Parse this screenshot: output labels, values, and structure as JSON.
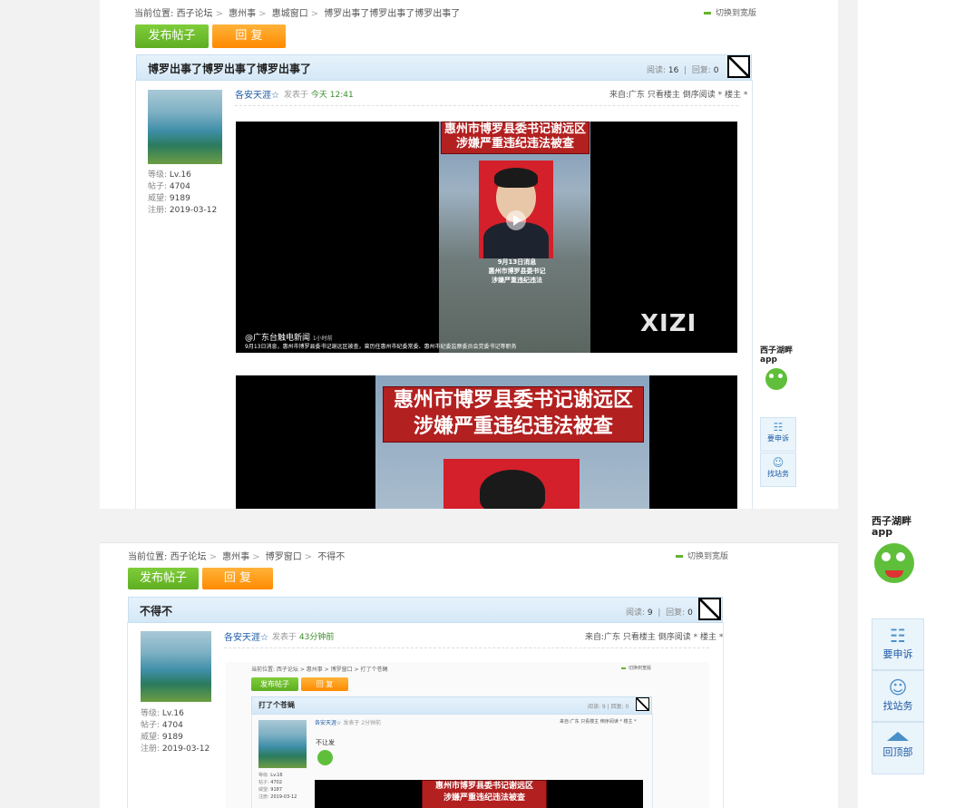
{
  "colors": {
    "accent_green": "#65b32e",
    "accent_orange": "#ff8a00",
    "bar_blue": "#d5e8f7",
    "link_blue": "#1d5aa6",
    "video_red": "#b32020"
  },
  "top_post": {
    "breadcrumb": {
      "prefix": "当前位置:",
      "items": [
        "西子论坛",
        "惠州事",
        "惠城窗口",
        "博罗出事了博罗出事了博罗出事了"
      ]
    },
    "widen_label": "切换到宽版",
    "buttons": {
      "post": "发布帖子",
      "reply": "回 复"
    },
    "title": "博罗出事了博罗出事了博罗出事了",
    "reads_label": "阅读:",
    "reads": "16",
    "replies_label": "回复:",
    "replies": "0",
    "author": {
      "name": "各安天涯☆",
      "meta": [
        {
          "k": "等级:",
          "v": "Lv.16"
        },
        {
          "k": "帖子:",
          "v": "4704"
        },
        {
          "k": "威望:",
          "v": "9189"
        },
        {
          "k": "注册:",
          "v": "2019-03-12"
        }
      ]
    },
    "posted_prefix": "发表于",
    "posted_time": "今天 12:41",
    "source": "来自:广东 只看楼主 倒序阅读 * 楼主 *",
    "video1": {
      "banner": [
        "惠州市博罗县委书记谢远区",
        "涉嫌严重违纪违法被查"
      ],
      "caption_lines": [
        "9月13日消息",
        "惠州市博罗县委书记",
        "涉嫌严重违纪违法"
      ],
      "channel": "@广东台触电新闻",
      "time_ago": "1小时前",
      "subtitle": "9月13日消息，惠州市博罗县委书记谢远区被查，曾历任惠州市纪委常委、惠州市纪委监察委员会党委书记等职务",
      "watermark": "XIZI"
    },
    "video2": {
      "banner": [
        "惠州市博罗县委书记谢远区",
        "涉嫌严重违纪违法被查"
      ]
    }
  },
  "side_small": {
    "app_line1": "西子湖畔",
    "app_line2": "app",
    "complain": "要申诉",
    "find": "找站务"
  },
  "bottom_post": {
    "breadcrumb": {
      "prefix": "当前位置:",
      "items": [
        "西子论坛",
        "惠州事",
        "博罗窗口",
        "不得不"
      ]
    },
    "widen_label": "切换到宽版",
    "buttons": {
      "post": "发布帖子",
      "reply": "回 复"
    },
    "title": "不得不",
    "reads_label": "阅读:",
    "reads": "9",
    "replies_label": "回复:",
    "replies": "0",
    "author": {
      "name": "各安天涯☆",
      "meta": [
        {
          "k": "等级:",
          "v": "Lv.16"
        },
        {
          "k": "帖子:",
          "v": "4704"
        },
        {
          "k": "威望:",
          "v": "9189"
        },
        {
          "k": "注册:",
          "v": "2019-03-12"
        }
      ]
    },
    "posted_prefix": "发表于",
    "posted_time": "43分钟前",
    "source": "来自:广东 只看楼主 倒序阅读 * 楼主 *"
  },
  "nested": {
    "breadcrumb": "当前位置: 西子论坛 > 惠州事 > 博罗窗口 > 打了个苍蝇",
    "widen_label": "切换到宽版",
    "buttons": {
      "post": "发布帖子",
      "reply": "回 复"
    },
    "title": "打了个苍蝇",
    "reads": "阅读: 9",
    "replies": "回复: 0",
    "author": "各安天涯☆",
    "posted": "发表于 2分钟前",
    "source": "来自:广东 只看楼主 倒序阅读 * 楼主 *",
    "body_text": "不让发",
    "meta": [
      {
        "k": "等级:",
        "v": "Lv.16"
      },
      {
        "k": "帖子:",
        "v": "4702"
      },
      {
        "k": "威望:",
        "v": "9187"
      },
      {
        "k": "注册:",
        "v": "2019-03-12"
      }
    ],
    "banner": [
      "惠州市博罗县委书记谢远区",
      "涉嫌严重违纪违法被查"
    ]
  },
  "side_big": {
    "app_line1": "西子湖畔",
    "app_line2": "app",
    "complain": "要申诉",
    "find": "找站务",
    "top": "回顶部"
  }
}
